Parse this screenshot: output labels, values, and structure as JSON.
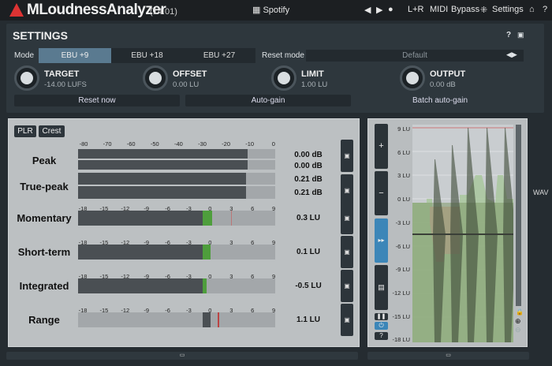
{
  "app": {
    "title": "MLoudnessAnalyzer",
    "version": "(14.01)",
    "preset": "Spotify",
    "channel": "L+R",
    "midi": "MIDI",
    "bypass": "Bypass",
    "settings": "Settings",
    "accent": "#3c86b8"
  },
  "settings": {
    "title": "SETTINGS",
    "help": "?",
    "mode_label": "Mode",
    "modes": [
      "EBU +9",
      "EBU +18",
      "EBU +27"
    ],
    "selected_mode": "EBU +9",
    "reset_mode_label": "Reset mode",
    "reset_mode_value": "Default",
    "knobs": [
      {
        "label": "TARGET",
        "value": "-14.00 LUFS"
      },
      {
        "label": "OFFSET",
        "value": "0.00 LU"
      },
      {
        "label": "LIMIT",
        "value": "1.00 LU"
      },
      {
        "label": "OUTPUT",
        "value": "0.00 dB"
      }
    ],
    "reset_now": "Reset now",
    "auto_gain": "Auto-gain",
    "batch_auto_gain": "Batch auto-gain"
  },
  "meters": {
    "plr": "PLR",
    "crest": "Crest",
    "peak_scale": [
      "-80",
      "-70",
      "-60",
      "-50",
      "-40",
      "-30",
      "-20",
      "-10",
      "0"
    ],
    "lu_scale": [
      "-18",
      "-15",
      "-12",
      "-9",
      "-6",
      "-3",
      "0",
      "3",
      "6",
      "9"
    ],
    "peak": {
      "label": "Peak",
      "values": [
        "0.00 dB",
        "0.00 dB"
      ],
      "levels_db": [
        -11,
        -11
      ]
    },
    "true_peak": {
      "label": "True-peak",
      "values": [
        "0.21 dB",
        "0.21 dB"
      ],
      "levels_db": [
        -11.5,
        -11.5
      ]
    },
    "momentary": {
      "label": "Momentary",
      "value": "0.3 LU",
      "level": 0.3
    },
    "short_term": {
      "label": "Short-term",
      "value": "0.1 LU",
      "level": 0.1
    },
    "integrated": {
      "label": "Integrated",
      "value": "-0.5 LU",
      "level": -0.5
    },
    "range": {
      "label": "Range",
      "value": "1.1 LU",
      "level": 1.1
    }
  },
  "history": {
    "scale": [
      "9 LU",
      "6 LU",
      "3 LU",
      "0 LU",
      "-3 LU",
      "-6 LU",
      "-9 LU",
      "-12 LU",
      "-15 LU",
      "-18 LU"
    ],
    "wav": "WAV",
    "help": "?"
  }
}
